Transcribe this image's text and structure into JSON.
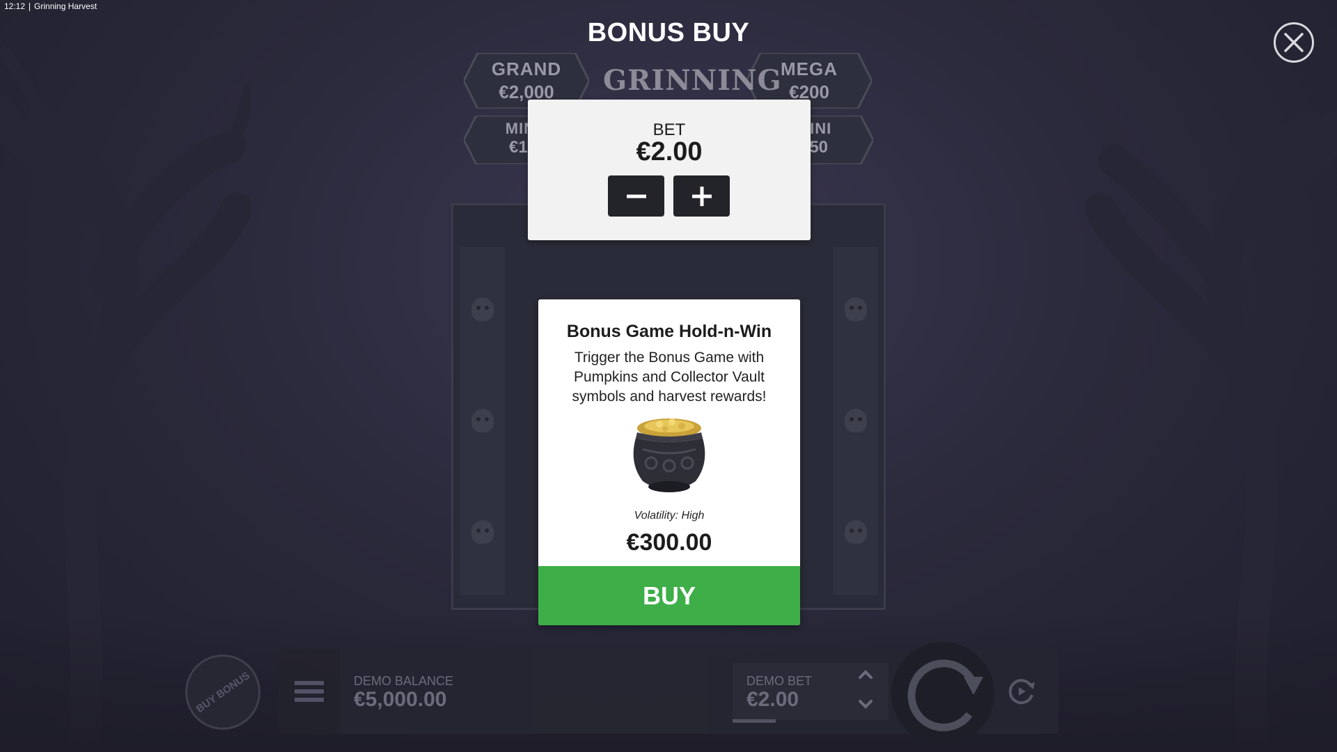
{
  "status": {
    "time": "12:12",
    "app_name": "Grinning Harvest"
  },
  "title": "BONUS BUY",
  "jackpots": [
    {
      "name": "GRAND",
      "value": "€2,000"
    },
    {
      "name": "MEGA",
      "value": "€200"
    },
    {
      "name": "MINI",
      "value": "€10"
    },
    {
      "name": "MINI",
      "value": "€50"
    }
  ],
  "logo_text": "GRINNING",
  "bet_panel": {
    "label": "BET",
    "value": "€2.00",
    "decrease_icon": "minus-icon",
    "increase_icon": "plus-icon"
  },
  "bonus_card": {
    "title": "Bonus Game Hold-n-Win",
    "description": "Trigger the Bonus Game with Pumpkins and Collector Vault symbols and harvest rewards!",
    "image": "cauldron-of-gold-coins",
    "volatility": "Volatility: High",
    "price": "€300.00",
    "buy_label": "BUY"
  },
  "controls": {
    "buy_bonus_label": "BUY BONUS",
    "balance_label": "DEMO BALANCE",
    "balance_value": "€5,000.00",
    "bet_label": "DEMO BET",
    "bet_value": "€2.00",
    "icons": [
      "menu-icon",
      "chevron-up-icon",
      "chevron-down-icon",
      "spin-icon",
      "autoplay-icon",
      "close-icon"
    ]
  },
  "colors": {
    "buy_green": "#3eae48",
    "panel_light": "#f2f2f2",
    "button_dark": "#23232a"
  }
}
